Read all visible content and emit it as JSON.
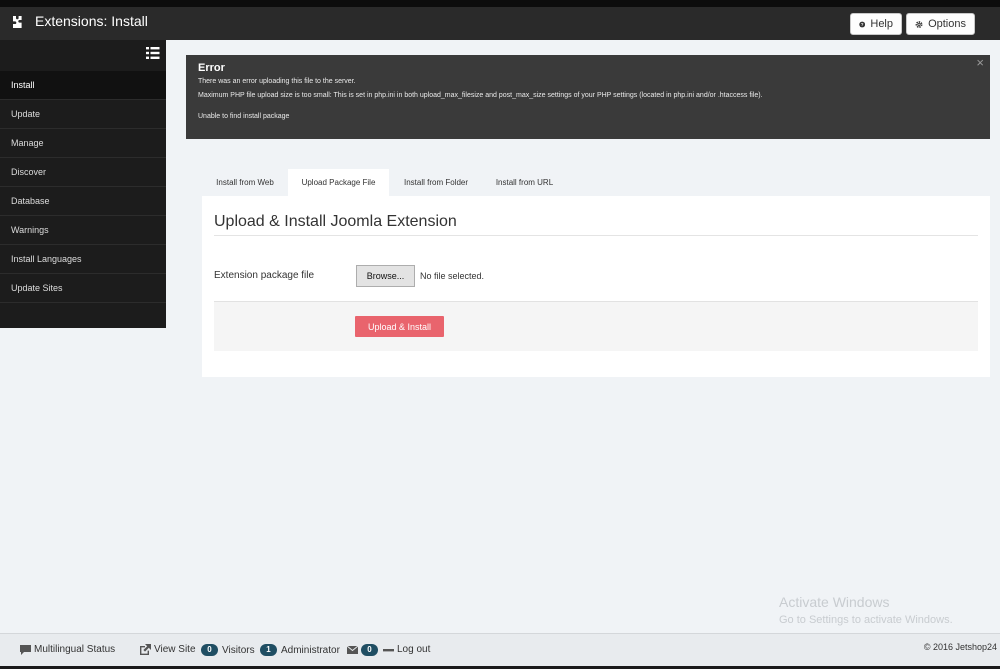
{
  "header": {
    "title": "Extensions: Install",
    "help_label": "Help",
    "options_label": "Options"
  },
  "sidebar": {
    "items": [
      {
        "label": "Install",
        "active": true
      },
      {
        "label": "Update"
      },
      {
        "label": "Manage"
      },
      {
        "label": "Discover"
      },
      {
        "label": "Database"
      },
      {
        "label": "Warnings"
      },
      {
        "label": "Install Languages"
      },
      {
        "label": "Update Sites"
      }
    ]
  },
  "alert": {
    "heading": "Error",
    "close": "×",
    "message1": "There was an error uploading this file to the server.",
    "message2": "Maximum PHP file upload size is too small: This is set in php.ini in both upload_max_filesize and post_max_size settings of your PHP settings (located in php.ini and/or .htaccess file).",
    "message3": "Unable to find install package"
  },
  "tabs": [
    {
      "label": "Install from Web"
    },
    {
      "label": "Upload Package File",
      "active": true
    },
    {
      "label": "Install from Folder"
    },
    {
      "label": "Install from URL"
    }
  ],
  "panel": {
    "title": "Upload & Install Joomla Extension",
    "field_label": "Extension package file",
    "browse_label": "Browse...",
    "no_file": "No file selected.",
    "upload_label": "Upload & Install"
  },
  "watermark": {
    "line1": "Activate Windows",
    "line2": "Go to Settings to activate Windows."
  },
  "footer": {
    "multilingual": "Multilingual Status",
    "view_site": "View Site",
    "visitors_count": "0",
    "visitors_label": "Visitors",
    "admin_count": "1",
    "admin_label": "Administrator",
    "messages_count": "0",
    "logout": "Log out",
    "copyright": "© 2016 Jetshop24"
  },
  "colors": {
    "header_bg": "#2a2a2a",
    "sidebar_bg": "#1c1c1c",
    "alert_bg": "#3a3a3a",
    "primary_button": "#e9646d",
    "badge": "#1f4e63"
  }
}
